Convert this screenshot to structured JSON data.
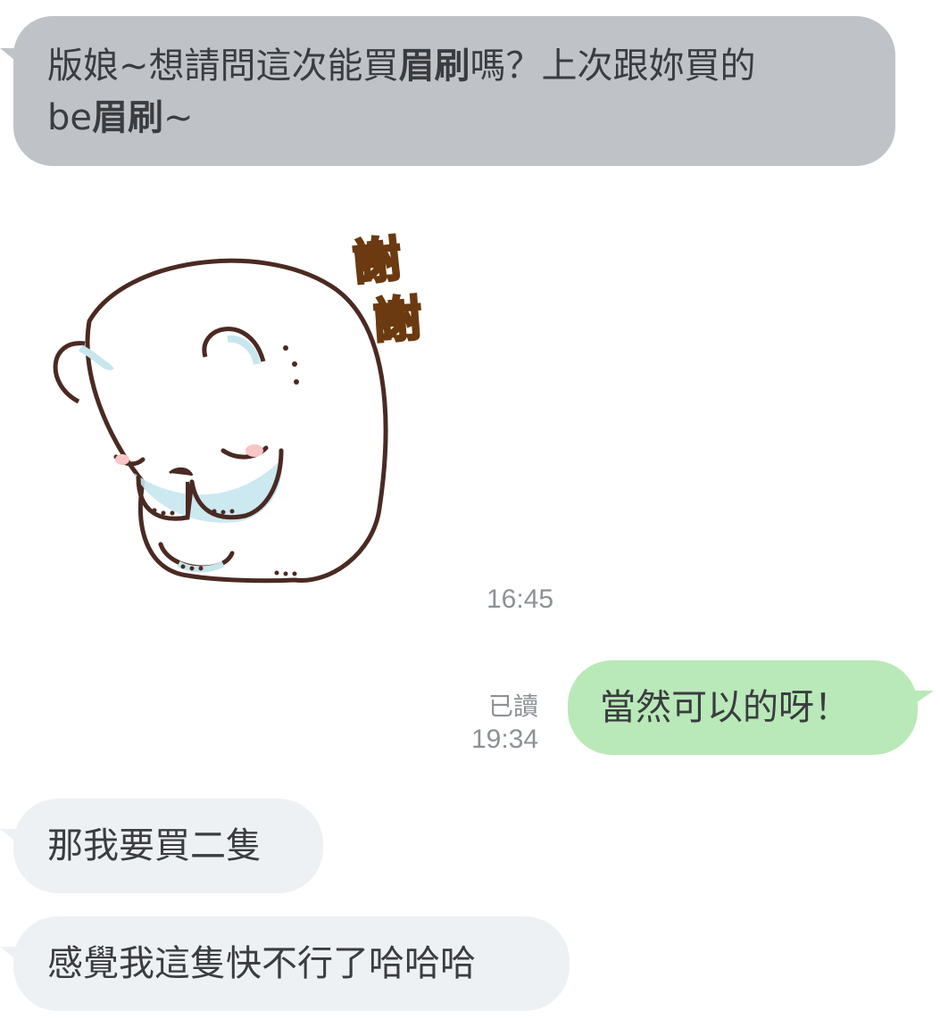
{
  "messages": [
    {
      "side": "left",
      "parts": [
        {
          "text": "版娘~想請問這次能買",
          "bold": false
        },
        {
          "text": "眉刷",
          "bold": true
        },
        {
          "text": "嗎？上次跟妳買的",
          "bold": false
        }
      ],
      "parts2": [
        {
          "text": "be",
          "bold": false
        },
        {
          "text": "眉刷",
          "bold": true
        },
        {
          "text": "~",
          "bold": false
        }
      ],
      "color": "#bfc3c7"
    },
    {
      "sticker": {
        "text_top": "謝",
        "text_bottom": "謝",
        "time": "16:45"
      }
    },
    {
      "side": "right",
      "text": "當然可以的呀！",
      "read": "已讀",
      "time": "19:34",
      "color": "#b9e9b8"
    },
    {
      "side": "left",
      "text": "那我要買二隻",
      "color": "#eef1f3"
    },
    {
      "side": "left",
      "text": "感覺我這隻快不行了哈哈哈",
      "color": "#eef1f3"
    }
  ]
}
